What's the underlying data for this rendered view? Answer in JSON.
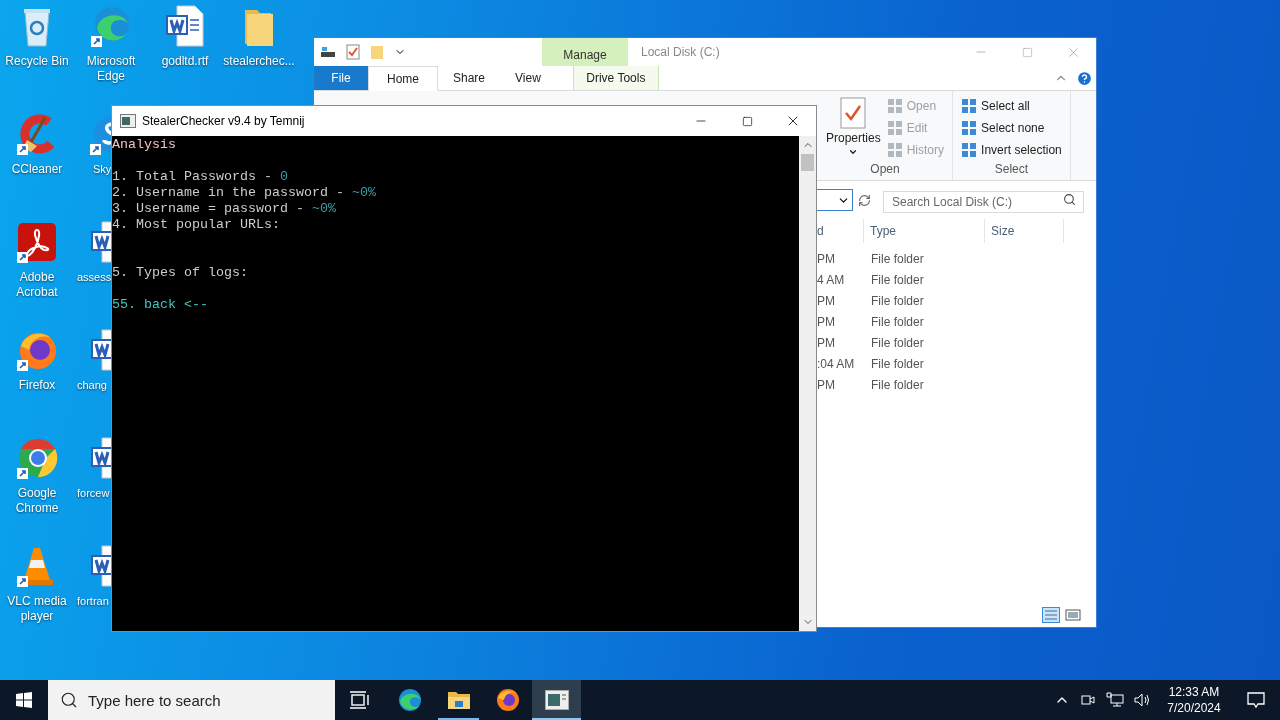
{
  "desktop_icons_top": [
    {
      "label": "Recycle Bin"
    },
    {
      "label": "Microsoft Edge"
    },
    {
      "label": "godltd.rtf"
    },
    {
      "label": "stealerchec..."
    }
  ],
  "desktop_icons_column_1": [
    {
      "label": "CCleaner"
    },
    {
      "label": "Adobe Acrobat"
    },
    {
      "label": "Firefox"
    },
    {
      "label": "Google Chrome"
    },
    {
      "label": "VLC media player"
    }
  ],
  "desktop_icons_column_2": [
    {
      "label": "Sky"
    },
    {
      "label": "assess"
    },
    {
      "label": "chang"
    },
    {
      "label": "forcew"
    },
    {
      "label": "fortran"
    }
  ],
  "explorer": {
    "title": "Local Disk (C:)",
    "context_group": "Manage",
    "context_tab": "Drive Tools",
    "tabs": [
      {
        "label": "File",
        "kind": "file",
        "selected": false
      },
      {
        "label": "Home",
        "kind": "tab",
        "selected": true
      },
      {
        "label": "Share",
        "kind": "tab",
        "selected": false
      },
      {
        "label": "View",
        "kind": "tab",
        "selected": false
      }
    ],
    "ribbon_groups": [
      {
        "label": "Open",
        "items": [
          {
            "label": "Properties",
            "kind": "large",
            "disabled": false
          },
          {
            "label": "Open",
            "kind": "small",
            "disabled": true
          },
          {
            "label": "Edit",
            "kind": "small",
            "disabled": true
          },
          {
            "label": "History",
            "kind": "small",
            "disabled": true
          }
        ]
      },
      {
        "label": "Select",
        "items": [
          {
            "label": "Select all",
            "kind": "small",
            "disabled": false
          },
          {
            "label": "Select none",
            "kind": "small",
            "disabled": false
          },
          {
            "label": "Invert selection",
            "kind": "small",
            "disabled": false
          }
        ]
      }
    ],
    "search": {
      "placeholder": "Search Local Disk (C:)"
    },
    "columns": [
      "d",
      "Type",
      "Size"
    ],
    "rows": [
      {
        "column_1": "PM",
        "type": "File folder"
      },
      {
        "column_1": "4 AM",
        "type": "File folder"
      },
      {
        "column_1": "PM",
        "type": "File folder"
      },
      {
        "column_1": "PM",
        "type": "File folder"
      },
      {
        "column_1": "PM",
        "type": "File folder"
      },
      {
        "column_1": ":04 AM",
        "type": "File folder"
      },
      {
        "column_1": "PM",
        "type": "File folder"
      }
    ]
  },
  "console": {
    "title": "StealerChecker v9.4 by Temnij",
    "lines": [
      {
        "segments": [
          {
            "text": "Analysis",
            "kind": "heading"
          }
        ]
      },
      {
        "segments": [
          {
            "text": "1. Total Passwords - ",
            "kind": "text"
          },
          {
            "text": "0",
            "kind": "value"
          }
        ]
      },
      {
        "segments": [
          {
            "text": "2. Username in the password - ",
            "kind": "text"
          },
          {
            "text": "~0%",
            "kind": "value"
          }
        ]
      },
      {
        "segments": [
          {
            "text": "3. Username = password - ",
            "kind": "text"
          },
          {
            "text": "~0%",
            "kind": "value"
          }
        ]
      },
      {
        "segments": [
          {
            "text": "4. Most popular URLs:",
            "kind": "text"
          }
        ]
      },
      {
        "segments": [
          {
            "text": "5. Types of logs:",
            "kind": "text"
          }
        ]
      },
      {
        "segments": [
          {
            "text": "55. back <--",
            "kind": "link"
          }
        ]
      }
    ]
  },
  "taskbar": {
    "search": {
      "placeholder": "Type here to search"
    },
    "apps": [
      {
        "running": false,
        "selected": false
      },
      {
        "running": true,
        "selected": false
      },
      {
        "running": false,
        "selected": false
      },
      {
        "running": true,
        "selected": true
      }
    ],
    "clock": {
      "time": "12:33 AM",
      "date": "7/20/2024"
    }
  }
}
